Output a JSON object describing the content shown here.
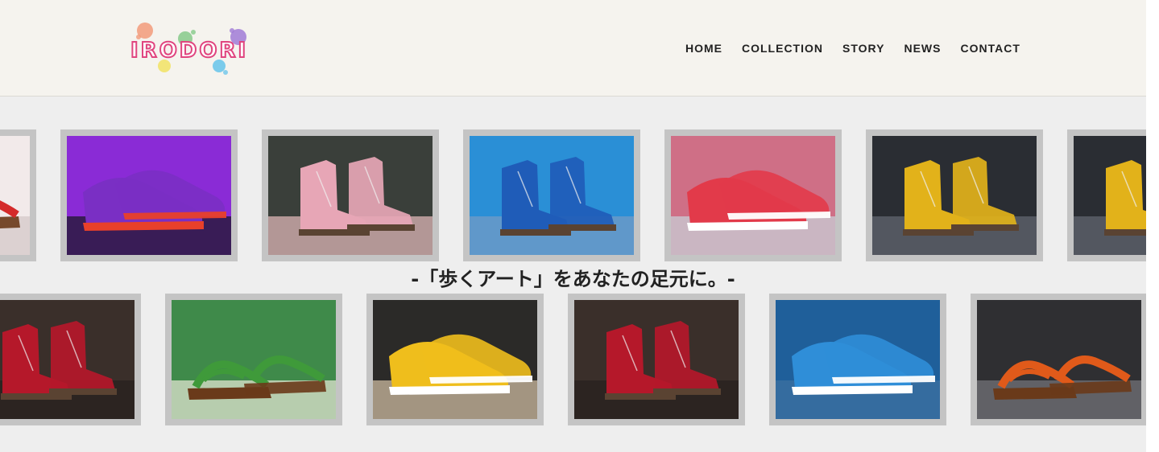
{
  "brand": {
    "logo_text": "IRODORI"
  },
  "nav": {
    "items": [
      "HOME",
      "COLLECTION",
      "STORY",
      "NEWS",
      "CONTACT"
    ]
  },
  "tagline": "-「歩くアート」をあなたの足元に。-",
  "gallery": {
    "row1": [
      {
        "name": "red-sandal",
        "shoe": "#d42a2a",
        "bg": "#f2eaea",
        "floor": "#d8cccc",
        "kind": "sandal"
      },
      {
        "name": "purple-sneaker",
        "shoe": "#7a2fc4",
        "bg": "#8a2bd6",
        "floor": "#2a1a40",
        "kind": "sneaker",
        "accent": "#e8402a"
      },
      {
        "name": "pink-boot",
        "shoe": "#e7a6b6",
        "bg": "#3a3f3a",
        "floor": "#c9a7a7",
        "kind": "boot"
      },
      {
        "name": "blue-boot",
        "shoe": "#1f5cb8",
        "bg": "#2a8fd6",
        "floor": "#6a9ac8",
        "kind": "boot"
      },
      {
        "name": "red-sneaker",
        "shoe": "#e23a4a",
        "bg": "#cf6f86",
        "floor": "#c9c3cc",
        "kind": "sneaker",
        "accent": "#ffffff"
      },
      {
        "name": "yellow-boot",
        "shoe": "#e2b21a",
        "bg": "#2a2d33",
        "floor": "#5a5f68",
        "kind": "boot"
      },
      {
        "name": "yellow-boot-2",
        "shoe": "#e2b21a",
        "bg": "#2a2d33",
        "floor": "#5a5f68",
        "kind": "boot"
      }
    ],
    "row2": [
      {
        "name": "red-boot",
        "shoe": "#b5182a",
        "bg": "#3a2f2a",
        "floor": "#2a2220",
        "kind": "boot"
      },
      {
        "name": "green-sandal",
        "shoe": "#3f9a3a",
        "bg": "#3f8a4a",
        "floor": "#cdd8c0",
        "kind": "sandal"
      },
      {
        "name": "yellow-sneaker",
        "shoe": "#efbe1c",
        "bg": "#2b2a28",
        "floor": "#b8a890",
        "kind": "sneaker",
        "accent": "#ffffff"
      },
      {
        "name": "red-boot-2",
        "shoe": "#b5182a",
        "bg": "#3a2f2a",
        "floor": "#2a2220",
        "kind": "boot"
      },
      {
        "name": "blue-sneaker",
        "shoe": "#2f8ed8",
        "bg": "#1f5f9a",
        "floor": "#3a6ea0",
        "kind": "sneaker",
        "accent": "#ffffff"
      },
      {
        "name": "orange-sandal",
        "shoe": "#e05a1a",
        "bg": "#2f2f32",
        "floor": "#6a6a70",
        "kind": "sandal"
      }
    ]
  },
  "colors": {
    "header_bg": "#f5f3ee",
    "page_bg": "#eeeeee",
    "tile_border": "#c4c4c4",
    "logo_outline": "#e0457f",
    "text": "#222222"
  }
}
